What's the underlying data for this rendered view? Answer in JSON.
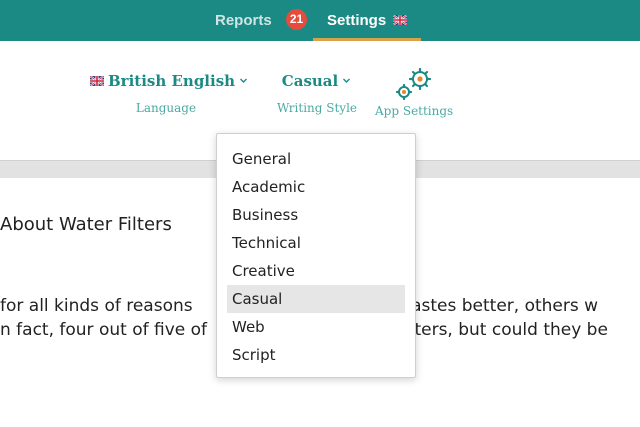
{
  "nav": {
    "reports_label": "Reports",
    "reports_badge": "21",
    "settings_label": "Settings"
  },
  "settings": {
    "language_value": "British English",
    "language_label": "Language",
    "style_value": "Casual",
    "style_label": "Writing Style",
    "app_settings_label": "App Settings"
  },
  "document": {
    "title": "About Water Filters",
    "line1": "for all kinds of reasons",
    "line1_right": "it tastes better, others w",
    "line2": "n fact, four out of five of",
    "line2_right": "ilters, but could they be",
    "line3": ""
  },
  "dropdown": {
    "items": [
      {
        "label": "General"
      },
      {
        "label": "Academic"
      },
      {
        "label": "Business"
      },
      {
        "label": "Technical"
      },
      {
        "label": "Creative"
      },
      {
        "label": "Casual",
        "selected": true
      },
      {
        "label": "Web"
      },
      {
        "label": "Script"
      }
    ]
  },
  "colors": {
    "brand": "#1c8a84",
    "badge": "#e74b3c",
    "active_tab_underline": "#d8a24a",
    "gear_orange": "#e8862a"
  },
  "icons": [
    "uk-flag-icon",
    "chevron-down-icon",
    "gears-icon"
  ]
}
